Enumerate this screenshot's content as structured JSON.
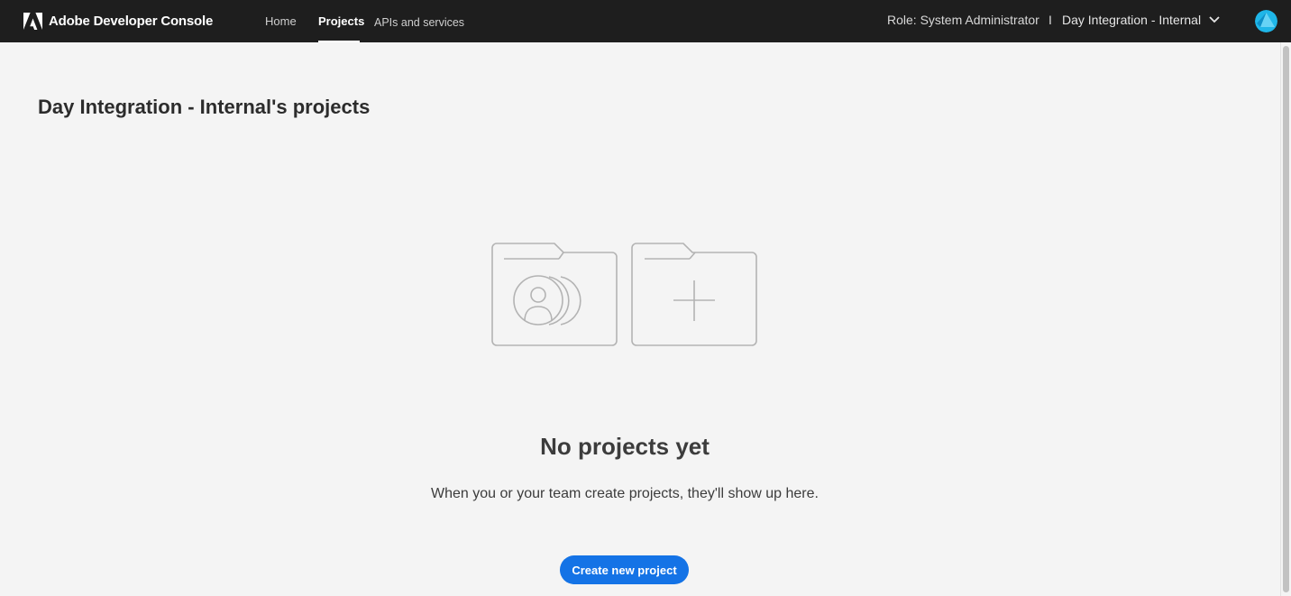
{
  "header": {
    "app_name": "Adobe Developer Console",
    "logo_icon": "adobe-logo-icon",
    "nav": [
      {
        "label": "Home",
        "active": false
      },
      {
        "label": "Projects",
        "active": true
      },
      {
        "label": "APIs and services",
        "active": false
      }
    ],
    "role_label": "Role: System Administrator",
    "separator": "I",
    "org_name": "Day Integration - Internal",
    "org_dropdown_icon": "chevron-down-icon",
    "avatar_icon": "user-avatar-icon"
  },
  "main": {
    "title": "Day Integration - Internal's projects",
    "illustration_icons": [
      "folder-people-icon",
      "folder-add-icon"
    ],
    "empty_title": "No projects yet",
    "empty_description": "When you or your team create projects, they'll show up here.",
    "create_button_label": "Create new project"
  },
  "colors": {
    "topbar": "#1e1e1e",
    "background": "#f4f4f4",
    "primary_button": "#1473e6",
    "illustration_stroke": "#b3b3b3"
  }
}
